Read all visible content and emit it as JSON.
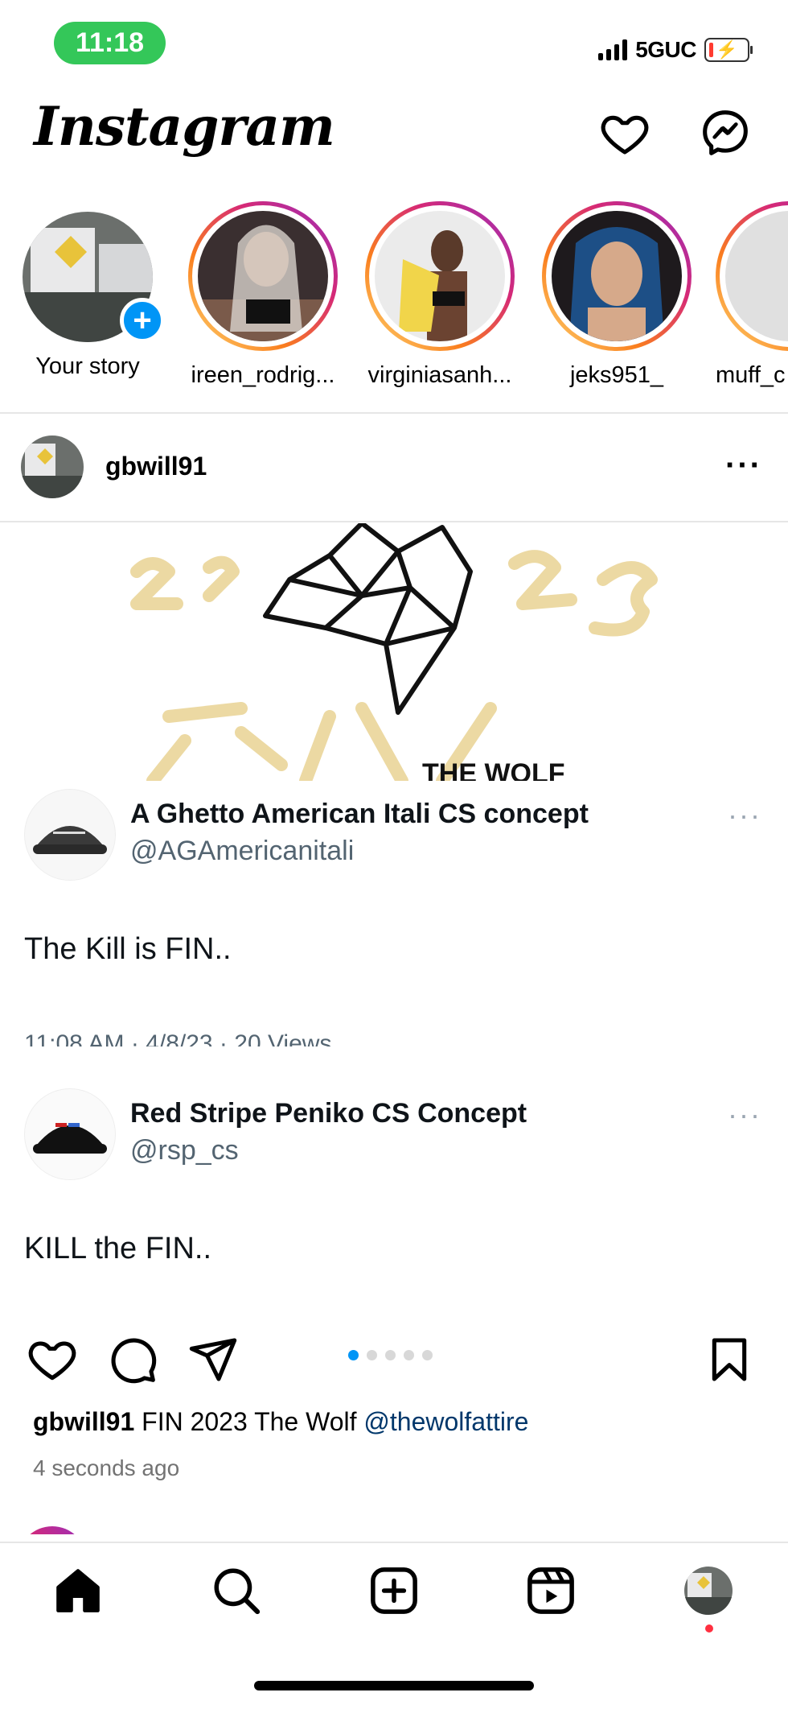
{
  "status_bar": {
    "time": "11:18",
    "network": "5GUC"
  },
  "header": {
    "logo": "Instagram"
  },
  "stories": [
    {
      "label": "Your story"
    },
    {
      "label": "ireen_rodrig..."
    },
    {
      "label": "virginiasanh..."
    },
    {
      "label": "jeks951_"
    },
    {
      "label": "muff_c"
    }
  ],
  "post": {
    "username": "gbwill91",
    "image_text": "THE WOLF",
    "tweets": [
      {
        "name": "A Ghetto American Itali CS concept",
        "handle": "@AGAmericanitali",
        "text": "The Kill is FIN..",
        "meta": "11:08 AM · 4/8/23 · 20 Views"
      },
      {
        "name": "Red Stripe Peniko CS Concept",
        "handle": "@rsp_cs",
        "text": "KILL the FIN.."
      }
    ],
    "carousel": {
      "count": 5,
      "active_index": 0
    },
    "caption_user": "gbwill91",
    "caption_text": " FIN 2023 The Wolf ",
    "caption_mention": "@thewolfattire",
    "time_ago": "4 seconds ago"
  },
  "colors": {
    "accent": "#0095f6",
    "mention": "#00376b",
    "status_green": "#34c759"
  }
}
